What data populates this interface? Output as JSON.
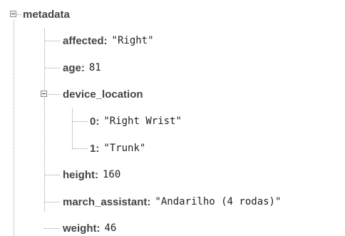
{
  "tree": {
    "root_key": "metadata",
    "root_children": [
      {
        "key": "affected",
        "value": "\"Right\""
      },
      {
        "key": "age",
        "value": "81"
      },
      {
        "key": "device_location",
        "value": ""
      },
      {
        "key": "height",
        "value": "160"
      },
      {
        "key": "march_assistant",
        "value": "\"Andarilho (4 rodas)\""
      },
      {
        "key": "weight",
        "value": "46"
      }
    ],
    "device_location_children": [
      {
        "key": "0",
        "value": "\"Right Wrist\""
      },
      {
        "key": "1",
        "value": "\"Trunk\""
      }
    ]
  },
  "icons": {
    "expand_toggle": "minus-square-icon"
  }
}
